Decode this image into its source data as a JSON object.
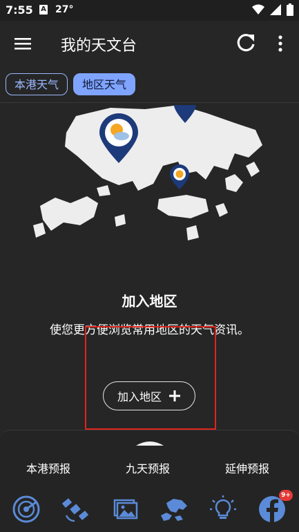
{
  "status_bar": {
    "time": "7:55",
    "notif_letter": "A",
    "temperature": "27°"
  },
  "app_bar": {
    "title": "我的天文台",
    "menu_icon": "hamburger-menu-icon",
    "refresh_icon": "refresh-icon",
    "more_icon": "more-vert-icon"
  },
  "tabs": [
    {
      "label": "本港天气",
      "selected": false
    },
    {
      "label": "地区天气",
      "selected": true
    }
  ],
  "empty_state": {
    "title": "加入地区",
    "description": "使您更方便浏览常用地区的天气资讯。",
    "add_button_label": "加入地区"
  },
  "bottom_panel": {
    "forecast_tabs": [
      "本港预报",
      "九天预报",
      "延伸预报"
    ],
    "nav_icons": [
      "radar-icon",
      "satellite-icon",
      "photo-icon",
      "hk-map-icon",
      "lightbulb-icon",
      "facebook-icon"
    ],
    "badge": "9+"
  },
  "colors": {
    "accent": "#7fa4ff",
    "highlight": "#e0251c",
    "background": "#262626",
    "nav_icon": "#5b8bd8"
  }
}
